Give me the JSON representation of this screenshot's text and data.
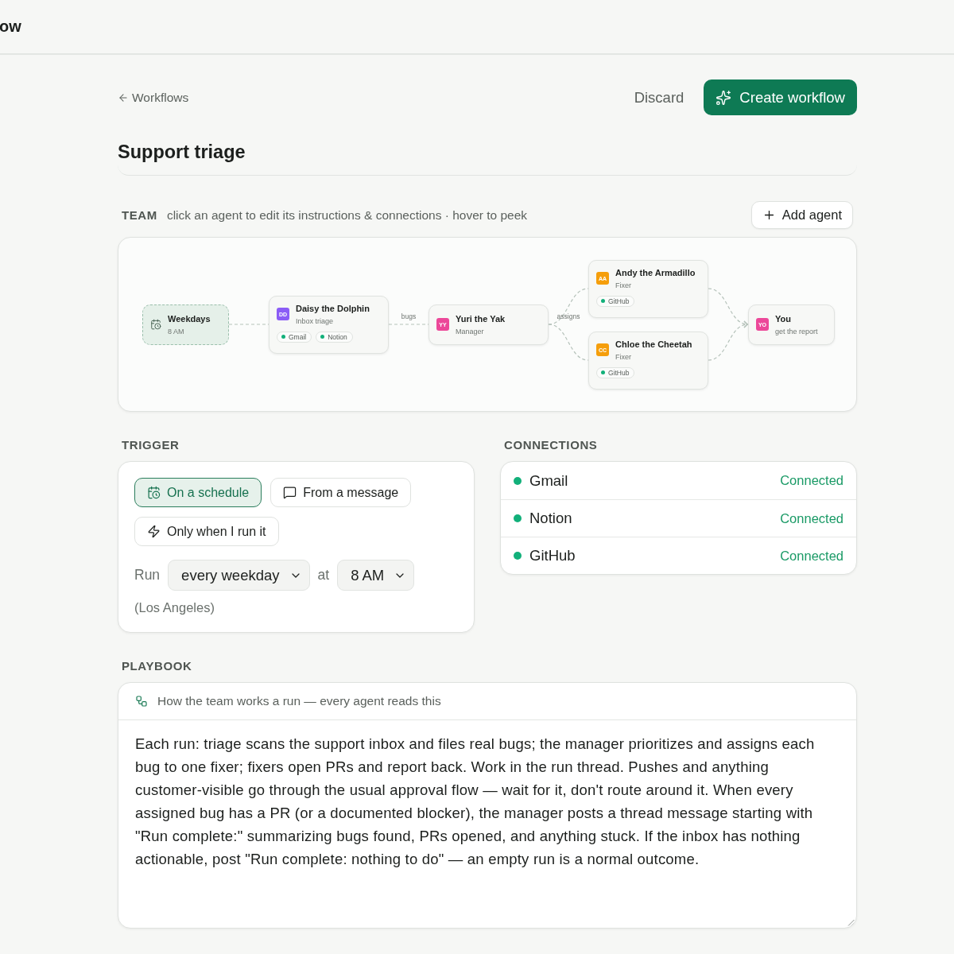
{
  "top_bar": {
    "title": "ow"
  },
  "header": {
    "back_link": "Workflows",
    "discard": "Discard",
    "create": "Create workflow"
  },
  "workflow_name": "Support triage",
  "team": {
    "label": "TEAM",
    "hint": "click an agent to edit its instructions & connections · hover to peek",
    "add_button": "Add agent",
    "columns": [
      {
        "nodes": [
          {
            "kind": "trigger",
            "title": "Weekdays",
            "subtitle": "8 AM"
          }
        ]
      },
      {
        "nodes": [
          {
            "kind": "agent",
            "initials": "DD",
            "color": "#8b5cf6",
            "name": "Daisy the Dolphin",
            "role": "Inbox triage",
            "connections": [
              {
                "name": "Gmail",
                "connected": true
              },
              {
                "name": "Notion",
                "connected": true
              }
            ]
          }
        ]
      },
      {
        "incoming_label": "bugs",
        "nodes": [
          {
            "kind": "agent",
            "initials": "YY",
            "color": "#ec4899",
            "name": "Yuri the Yak",
            "role": "Manager"
          }
        ]
      },
      {
        "incoming_label": "assigns",
        "nodes": [
          {
            "kind": "agent",
            "initials": "AA",
            "color": "#f59e0b",
            "name": "Andy the Armadillo",
            "role": "Fixer",
            "connections": [
              {
                "name": "GitHub",
                "connected": true
              }
            ]
          },
          {
            "kind": "agent",
            "initials": "CC",
            "color": "#f59e0b",
            "name": "Chloe the Cheetah",
            "role": "Fixer",
            "connections": [
              {
                "name": "GitHub",
                "connected": true
              }
            ]
          }
        ]
      },
      {
        "nodes": [
          {
            "kind": "recipient",
            "initials": "YO",
            "color": "#ec4899",
            "name": "You",
            "role": "get the report"
          }
        ]
      }
    ]
  },
  "trigger": {
    "label": "TRIGGER",
    "options": [
      {
        "kind": "schedule",
        "label": "On a schedule",
        "selected": true
      },
      {
        "kind": "message",
        "label": "From a message",
        "selected": false
      },
      {
        "kind": "manual",
        "label": "Only when I run it",
        "selected": false
      }
    ],
    "schedule": {
      "run_label": "Run",
      "frequency": "every weekday",
      "at_label": "at",
      "time": "8 AM",
      "timezone": "(Los Angeles)"
    }
  },
  "connections": {
    "label": "CONNECTIONS",
    "items": [
      {
        "name": "Gmail",
        "status": "Connected",
        "connected": true
      },
      {
        "name": "Notion",
        "status": "Connected",
        "connected": true
      },
      {
        "name": "GitHub",
        "status": "Connected",
        "connected": true
      }
    ]
  },
  "playbook": {
    "label": "PLAYBOOK",
    "caption": "How the team works a run — every agent reads this",
    "text": "Each run: triage scans the support inbox and files real bugs; the manager prioritizes and assigns each bug to one fixer; fixers open PRs and report back. Work in the run thread. Pushes and anything customer-visible go through the usual approval flow — wait for it, don't route around it. When every assigned bug has a PR (or a documented blocker), the manager posts a thread message starting with \"Run complete:\" summarizing bugs found, PRs opened, and anything stuck. If the inbox has nothing actionable, post \"Run complete: nothing to do\" — an empty run is a normal outcome."
  }
}
